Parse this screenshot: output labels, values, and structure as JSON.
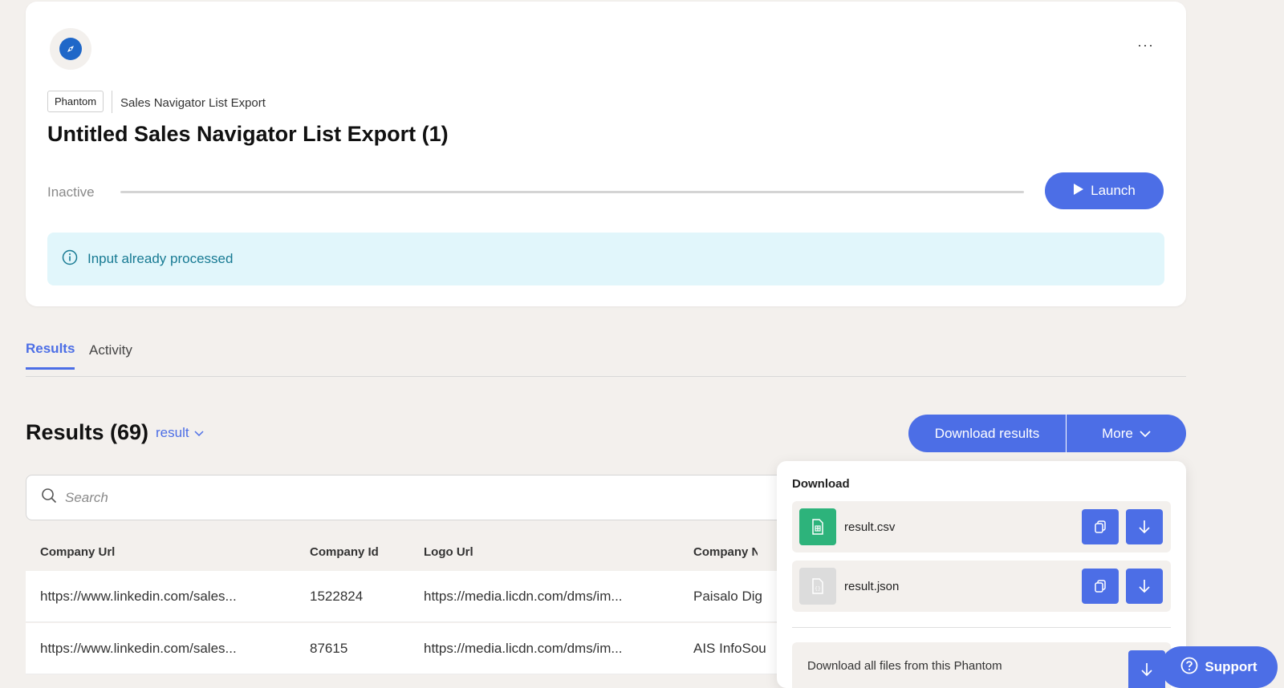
{
  "phantom": {
    "tag": "Phantom",
    "breadcrumb": "Sales Navigator List Export",
    "title": "Untitled Sales Navigator List Export (1)",
    "status": "Inactive",
    "launch_label": "Launch",
    "more_label": "···",
    "alert_text": "Input already processed"
  },
  "tabs": [
    {
      "label": "Results",
      "active": true
    },
    {
      "label": "Activity",
      "active": false
    }
  ],
  "results": {
    "title": "Results (69)",
    "filter_label": "result",
    "download_label": "Download results",
    "more_label": "More",
    "search_placeholder": "Search"
  },
  "table": {
    "columns": [
      "Company Url",
      "Company Id",
      "Logo Url",
      "Company Na"
    ],
    "rows": [
      [
        "https://www.linkedin.com/sales...",
        "1522824",
        "https://media.licdn.com/dms/im...",
        "Paisalo Dig"
      ],
      [
        "https://www.linkedin.com/sales...",
        "87615",
        "https://media.licdn.com/dms/im...",
        "AIS InfoSou"
      ]
    ]
  },
  "download_menu": {
    "heading": "Download",
    "files": [
      {
        "name": "result.csv",
        "icon": "csv-file-icon",
        "color": "#2db37b"
      },
      {
        "name": "result.json",
        "icon": "json-file-icon",
        "color": "#dcdcdc"
      }
    ],
    "all_label": "Download all files from this Phantom"
  },
  "support_label": "Support",
  "colors": {
    "accent": "#4c6ee6",
    "page_bg": "#f3f0ed",
    "info_bg": "#e1f6fb",
    "info_text": "#177a93"
  }
}
